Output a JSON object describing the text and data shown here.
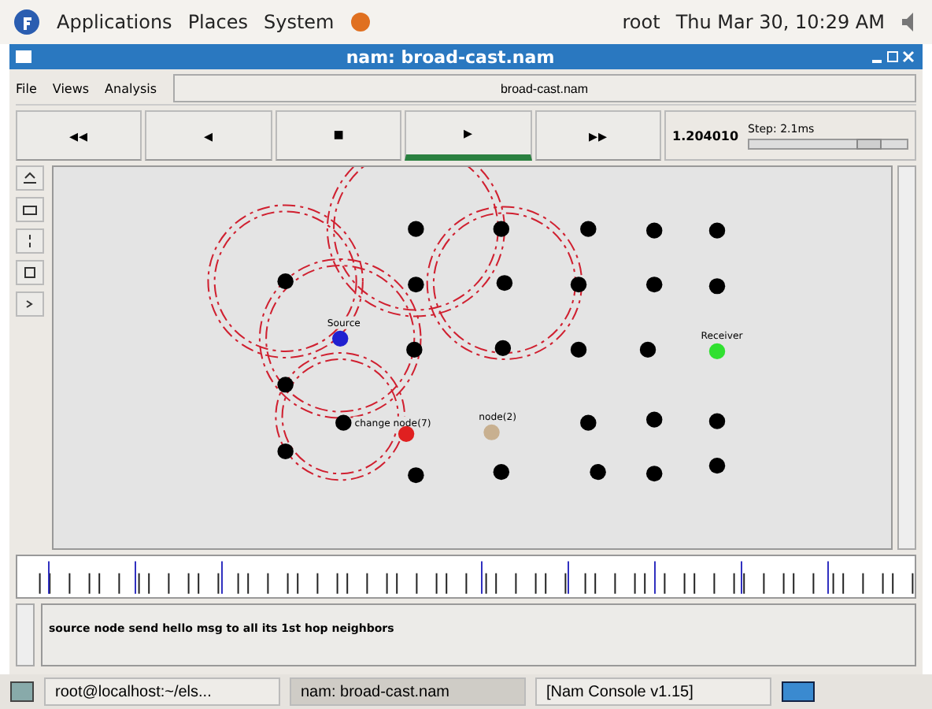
{
  "top_panel": {
    "menus": [
      "Applications",
      "Places",
      "System"
    ],
    "user": "root",
    "clock": "Thu Mar 30, 10:29 AM"
  },
  "window": {
    "title": "nam: broad-cast.nam"
  },
  "menu": [
    "File",
    "Views",
    "Analysis"
  ],
  "file_field": {
    "value": "broad-cast.nam"
  },
  "controls": [
    {
      "glyph": "◂◂",
      "selected": false
    },
    {
      "glyph": "◂",
      "selected": false
    },
    {
      "glyph": "■",
      "selected": false
    },
    {
      "glyph": "▸",
      "selected": true
    },
    {
      "glyph": "▸▸",
      "selected": false
    }
  ],
  "time": "1.204010",
  "step": {
    "label": "Step: 2.1ms",
    "level": 0.75
  },
  "nodes": [
    {
      "color": "#000000"
    },
    {
      "color": "#000000"
    },
    {
      "color": "#000000"
    },
    {
      "color": "#000000"
    },
    {
      "color": "#000000"
    },
    {
      "color": "#000000"
    },
    {
      "color": "#000000"
    },
    {
      "color": "#000000"
    },
    {
      "color": "#000000"
    },
    {
      "color": "#000000"
    },
    {
      "color": "#000000"
    },
    {
      "color": "#2020d0",
      "label": "Source"
    },
    {
      "color": "#000000"
    },
    {
      "color": "#000000"
    },
    {
      "color": "#000000"
    },
    {
      "color": "#000000"
    },
    {
      "color": "#30e030",
      "label": "Receiver"
    },
    {
      "color": "#000000"
    },
    {
      "color": "#000000",
      "label": "change node(7)"
    },
    {
      "color": "#e02020"
    },
    {
      "color": "#c8b090",
      "label": "node(2)"
    },
    {
      "color": "#000000"
    },
    {
      "color": "#000000"
    },
    {
      "color": "#000000"
    },
    {
      "color": "#000000"
    },
    {
      "color": "#000000"
    },
    {
      "color": "#000000"
    },
    {
      "color": "#000000"
    },
    {
      "color": "#000000"
    },
    {
      "color": "#000000"
    }
  ],
  "annotation": "source node send hello msg to all its 1st hop neighbors",
  "taskbar": [
    {
      "label": "root@localhost:~/els...",
      "selected": false
    },
    {
      "label": "nam: broad-cast.nam",
      "selected": true
    },
    {
      "label": "[Nam Console v1.15]",
      "selected": false
    }
  ]
}
